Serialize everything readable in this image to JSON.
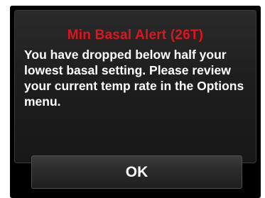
{
  "alert": {
    "title": "Min Basal Alert (26T)",
    "message": "You have dropped below half your lowest basal setting. Please review your current temp rate in the Options menu.",
    "title_color": "#e0141e"
  },
  "actions": {
    "ok_label": "OK"
  }
}
